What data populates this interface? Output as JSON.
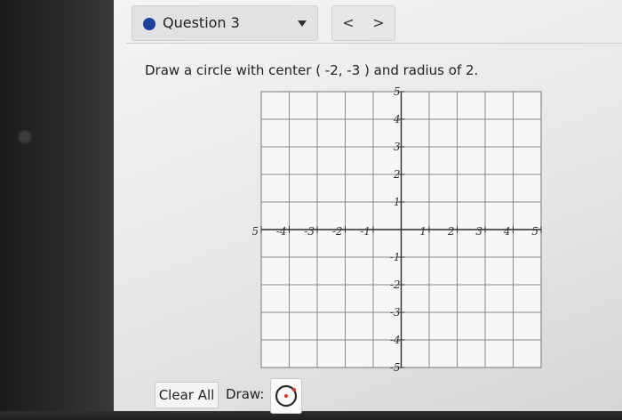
{
  "question": {
    "label": "Question 3",
    "status_color": "#1f3f9c"
  },
  "nav": {
    "prev": "<",
    "next": ">"
  },
  "prompt": "Draw a circle with center ( -2, -3 ) and radius of 2.",
  "graph": {
    "x_ticks": [
      "-5",
      "-4",
      "-3",
      "-2",
      "-1",
      "1",
      "2",
      "3",
      "4",
      "5"
    ],
    "y_ticks": [
      "5",
      "4",
      "3",
      "2",
      "1",
      "-1",
      "-2",
      "-3",
      "-4",
      "-5"
    ],
    "xlim": [
      -5,
      5
    ],
    "ylim": [
      -5,
      5
    ],
    "grid": true
  },
  "controls": {
    "clear_label": "Clear All",
    "draw_label": "Draw:",
    "tool_icon": "circle-tool-icon",
    "tool_color": "#d9362b"
  }
}
